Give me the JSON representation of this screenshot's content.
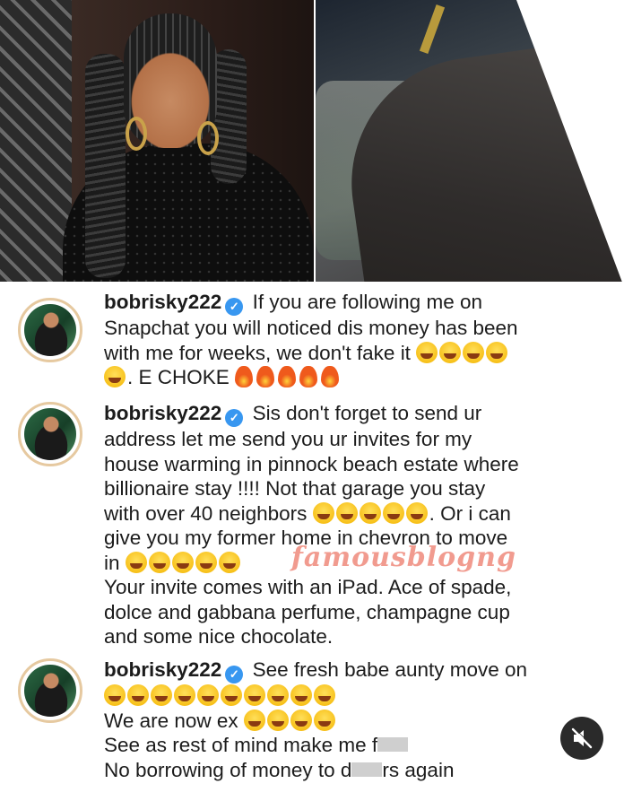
{
  "comments": [
    {
      "username": "bobrisky222",
      "line1": "If you are following me on",
      "line2": "Snapchat you will noticed dis money has been",
      "line3": "with me for weeks, we don't fake it",
      "line4": ". E CHOKE"
    },
    {
      "username": "bobrisky222",
      "line1": "Sis don't forget to send ur",
      "line2": "address let me send you ur invites for my",
      "line3": "house warming in pinnock beach estate where",
      "line4": "billionaire stay !!!! Not that garage you stay",
      "line5a": "with over 40 neighbors",
      "line5b": ". Or i can",
      "line6": "give you my former home in chevron to move",
      "line7": "in",
      "line8": "Your invite comes with an iPad. Ace of spade,",
      "line9": "dolce and gabbana perfume, champagne cup",
      "line10": "and some nice chocolate."
    },
    {
      "username": "bobrisky222",
      "line1": "See fresh babe aunty move on",
      "line3": "We are now ex",
      "line4": "See as rest of mind make me f",
      "line5a": "No borrowing of money to d",
      "line5b": "rs again"
    }
  ],
  "watermark": "famousblogng",
  "icons": {
    "verified": "verified-badge-icon",
    "laugh": "laughing-face-emoji",
    "fire": "fire-emoji",
    "mute": "muted-speaker-icon"
  },
  "colors": {
    "verified": "#3897f0",
    "watermark": "#ef8a7c"
  }
}
